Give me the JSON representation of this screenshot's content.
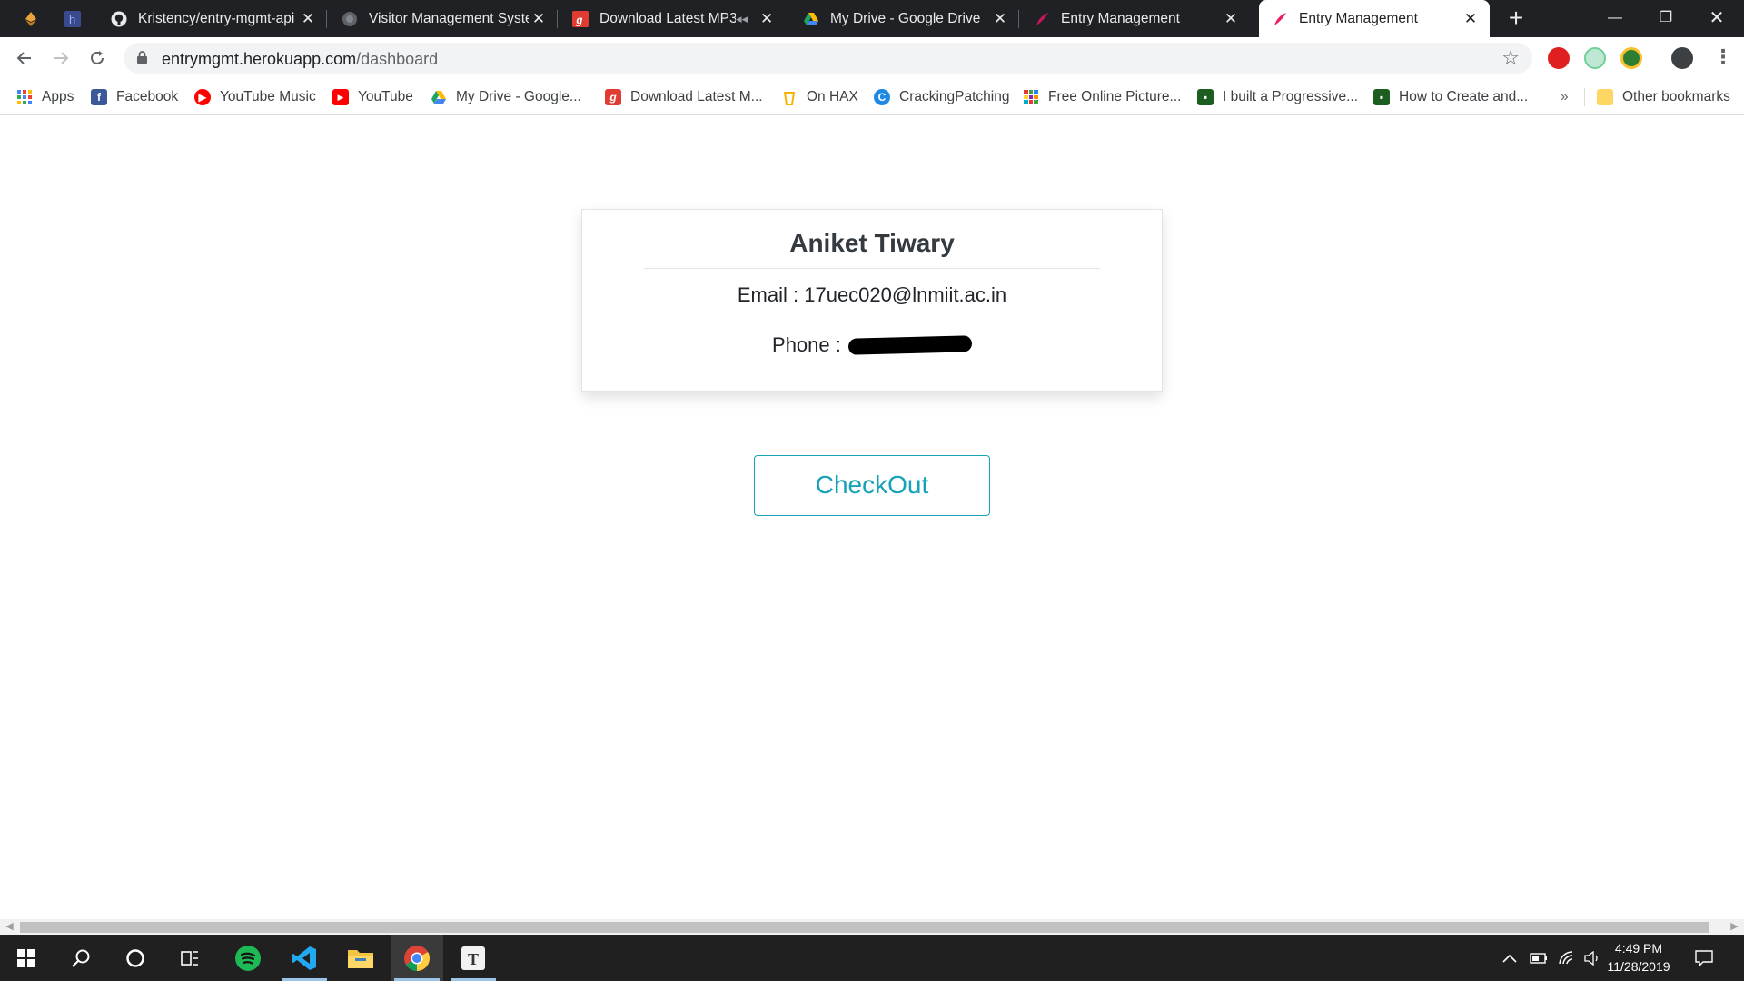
{
  "browser": {
    "tabs": [
      {
        "title": "Kristency/entry-mgmt-api",
        "favicon": "github-icon"
      },
      {
        "title": "Visitor Management System",
        "favicon": "globe-icon"
      },
      {
        "title": "Download Latest MP3",
        "favicon": "g-icon"
      },
      {
        "title": "My Drive - Google Drive",
        "favicon": "drive-icon"
      },
      {
        "title": "Entry Management",
        "favicon": "feather-icon"
      },
      {
        "title": "Entry Management",
        "favicon": "feather-icon",
        "active": true
      }
    ],
    "url_host": "entrymgmt.herokuapp.com",
    "url_path": "/dashboard",
    "bookmarks": [
      "Apps",
      "Facebook",
      "YouTube Music",
      "YouTube",
      "My Drive - Google...",
      "Download Latest M...",
      "On HAX",
      "CrackingPatching",
      "Free Online Picture...",
      "I built a Progressive...",
      "How to Create and..."
    ],
    "bookmarks_overflow": "»",
    "other_bookmarks": "Other bookmarks"
  },
  "profile": {
    "name": "Aniket Tiwary",
    "email_label": "Email :",
    "email": "17uec020@lnmiit.ac.in",
    "phone_label": "Phone :",
    "phone_value": "redacted"
  },
  "actions": {
    "checkout_label": "CheckOut"
  },
  "taskbar": {
    "time": "4:49 PM",
    "date": "11/28/2019"
  },
  "colors": {
    "accent": "#17a2b8",
    "tabstrip": "#202124",
    "taskbar": "#202020"
  }
}
